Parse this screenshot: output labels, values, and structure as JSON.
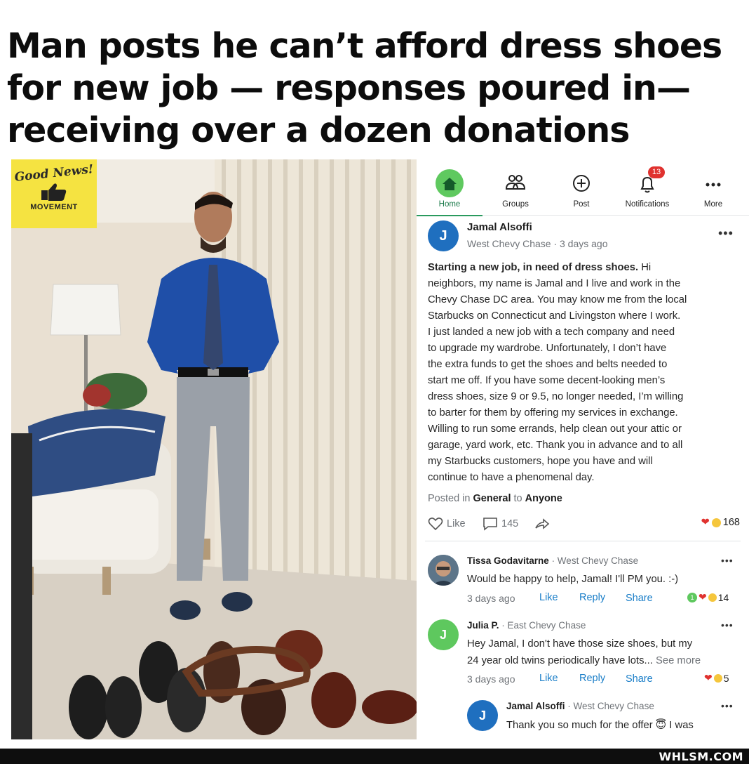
{
  "headline": {
    "line1": "Man posts he can’t afford dress shoes",
    "line2": "for new job — responses poured in—",
    "line3": "receiving over a dozen donations"
  },
  "badge": {
    "script": "Good News!",
    "movement": "MOVEMENT"
  },
  "nav": {
    "items": [
      {
        "label": "Home",
        "icon": "home-icon",
        "active": true
      },
      {
        "label": "Groups",
        "icon": "groups-icon"
      },
      {
        "label": "Post",
        "icon": "plus-circle-icon"
      },
      {
        "label": "Notifications",
        "icon": "bell-icon",
        "badge": "13"
      },
      {
        "label": "More",
        "icon": "more-dots-icon"
      }
    ]
  },
  "post": {
    "avatar_initial": "J",
    "author": "Jamal Alsoffi",
    "meta": "West Chevy Chase · 3 days ago",
    "lines": [
      {
        "bold": "Starting a new job, in need of dress shoes.",
        "text": " Hi"
      },
      {
        "text": "neighbors, my name is Jamal and I live and work in the"
      },
      {
        "text": "Chevy Chase DC area. You may know me from the local"
      },
      {
        "text": "Starbucks on Connecticut and Livingston where I work."
      },
      {
        "text": "I just landed a new job with a tech company and need"
      },
      {
        "text": "to upgrade my wardrobe. Unfortunately, I don’t have"
      },
      {
        "text": "the extra funds to get the shoes and belts needed to"
      },
      {
        "text": "start me off. If you have some decent-looking men’s"
      },
      {
        "text": "dress shoes, size 9 or 9.5, no longer needed, I’m willing"
      },
      {
        "text": "to barter for them by offering my services in exchange."
      },
      {
        "text": "Willing to run some errands, help clean out your attic or"
      },
      {
        "text": "garage, yard work, etc. Thank you in advance and to all"
      },
      {
        "text": "my Starbucks customers, hope you have and will"
      },
      {
        "text": "continue to have a phenomenal day."
      }
    ],
    "posted_prefix": "Posted in",
    "posted_group": "General",
    "posted_to": "to",
    "posted_audience": "Anyone",
    "like_label": "Like",
    "comment_count": "145",
    "reaction_count": "168"
  },
  "comments": [
    {
      "author": "Tissa Godavitarne",
      "location": " · West Chevy Chase",
      "text": "Would be happy to help, Jamal!  I'll PM you. :-)",
      "time": "3 days ago",
      "like": "Like",
      "reply": "Reply",
      "share": "Share",
      "reactions": "14",
      "reaction_prefix": "1"
    },
    {
      "avatar_initial": "J",
      "author": "Julia P.",
      "location": " · East Chevy Chase",
      "text": "Hey Jamal, I don't have those size shoes, but my",
      "text2": "24 year old twins periodically have lots...",
      "see_more": "See more",
      "time": "3 days ago",
      "like": "Like",
      "reply": "Reply",
      "share": "Share",
      "reactions": "5"
    },
    {
      "avatar_initial": "J",
      "author": "Jamal Alsoffi",
      "location": " · West Chevy Chase",
      "text": "Thank you so much for the offer 😇 I was"
    }
  ],
  "footer": {
    "brand": "WHLSM.COM"
  },
  "colors": {
    "accent_green": "#2a9a5e",
    "link_blue": "#1a7ec8",
    "notification_red": "#e0322f",
    "badge_yellow": "#f5e341"
  }
}
